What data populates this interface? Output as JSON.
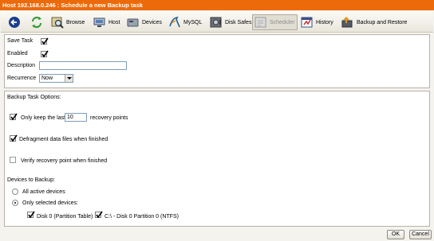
{
  "window": {
    "title": "Host 192.168.0.246 : Schedule a new Backup task"
  },
  "toolbar": {
    "items": [
      {
        "label": "",
        "icon": "back-arrow-icon"
      },
      {
        "label": "",
        "icon": "refresh-icon"
      },
      {
        "label": "Browse",
        "icon": "browse-icon"
      },
      {
        "label": "Host",
        "icon": "host-icon"
      },
      {
        "label": "Devices",
        "icon": "devices-icon"
      },
      {
        "label": "MySQL",
        "icon": "mysql-icon"
      },
      {
        "label": "Disk Safes",
        "icon": "disk-safes-icon"
      },
      {
        "label": "Scheduler",
        "icon": "scheduler-icon",
        "active": true
      },
      {
        "label": "History",
        "icon": "history-icon"
      },
      {
        "label": "Backup and Restore",
        "icon": "backup-restore-icon"
      }
    ]
  },
  "task": {
    "save_task_label": "Save Task",
    "save_task_checked": true,
    "enabled_label": "Enabled",
    "enabled_checked": true,
    "description_label": "Description",
    "description_value": "",
    "recurrence_label": "Recurrence",
    "recurrence_value": "Now"
  },
  "options": {
    "heading": "Backup Task Options:",
    "keep_last_label": "Only keep the last",
    "keep_last_checked": true,
    "keep_last_value": "10",
    "recovery_points_label": "recovery points",
    "defragment_label": "Defragment data files when finished",
    "defragment_checked": true,
    "verify_label": "Verify recovery point when finished",
    "verify_checked": false,
    "devices_heading": "Devices to Backup:",
    "all_devices_label": "All active devices",
    "selected_devices_label": "Only selected devices:",
    "selected_mode": "selected",
    "device1_label": "Disk 0 (Partition Table)",
    "device1_checked": true,
    "device2_label": "C:\\ - Disk 0 Partition 0 (NTFS)",
    "device2_checked": true
  },
  "buttons": {
    "ok": "OK",
    "cancel": "Cancel"
  },
  "colors": {
    "titlebar": "#ec6a0a",
    "titlebar_text": "#ffffff",
    "panel_border": "#b6b3a9"
  }
}
